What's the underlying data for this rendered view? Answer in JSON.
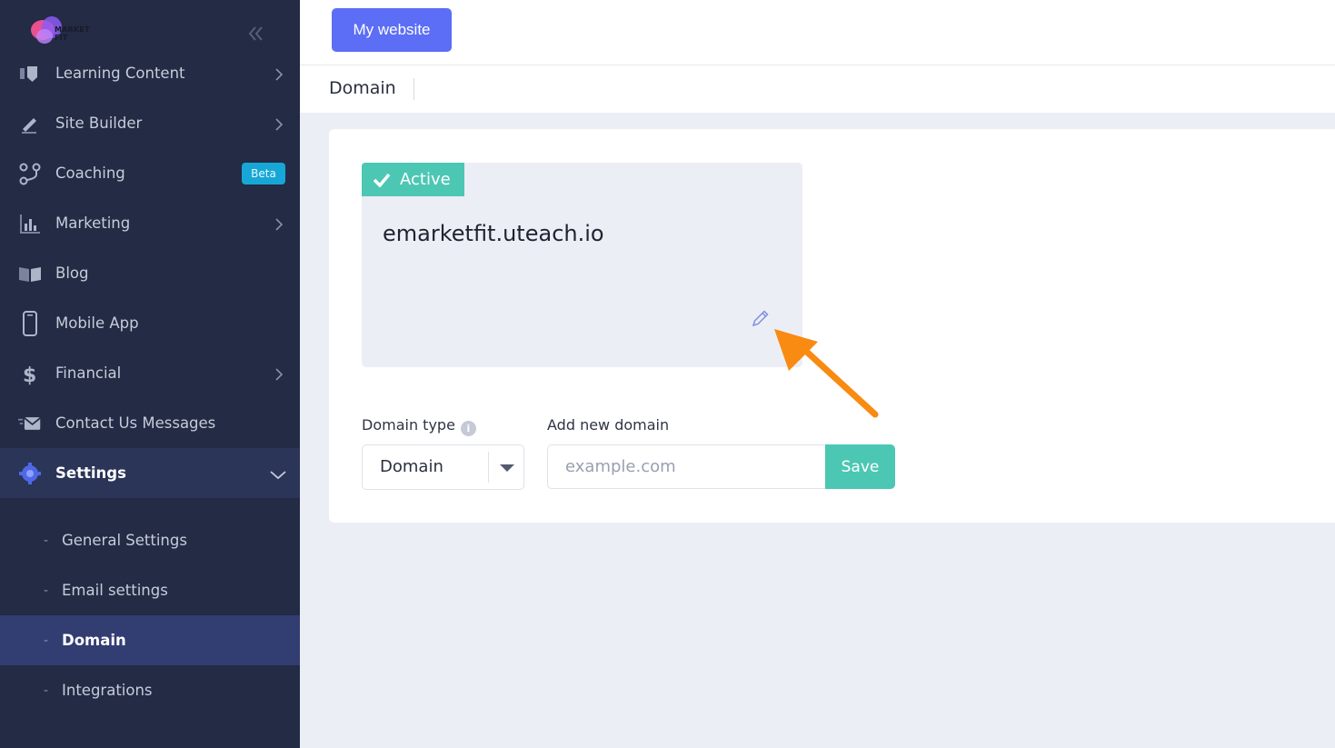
{
  "sidebar": {
    "logo_text": "MARKET FIT",
    "items": [
      {
        "label": "Learning Content",
        "icon": "learning-icon",
        "chevron": true
      },
      {
        "label": "Site Builder",
        "icon": "pencil-icon",
        "chevron": true
      },
      {
        "label": "Coaching",
        "icon": "coaching-icon",
        "badge": "Beta"
      },
      {
        "label": "Marketing",
        "icon": "chart-icon",
        "chevron": true
      },
      {
        "label": "Blog",
        "icon": "book-icon"
      },
      {
        "label": "Mobile App",
        "icon": "mobile-icon"
      },
      {
        "label": "Financial",
        "icon": "dollar-icon",
        "chevron": true
      },
      {
        "label": "Contact Us Messages",
        "icon": "envelope-icon"
      },
      {
        "label": "Settings",
        "icon": "gear-icon",
        "expanded": true
      }
    ],
    "settings_sub": [
      {
        "label": "General Settings"
      },
      {
        "label": "Email settings"
      },
      {
        "label": "Domain",
        "selected": true
      },
      {
        "label": "Integrations"
      }
    ]
  },
  "topbar": {
    "my_website_label": "My website"
  },
  "page": {
    "title": "Domain"
  },
  "domain_card": {
    "status": "Active",
    "domain": "emarketfit.uteach.io"
  },
  "form": {
    "domain_type_label": "Domain type",
    "domain_type_value": "Domain",
    "add_domain_label": "Add new domain",
    "add_domain_placeholder": "example.com",
    "save_label": "Save"
  },
  "colors": {
    "sidebar_bg": "#232b45",
    "accent_teal": "#4cc7b3",
    "button_blue": "#5b6ef5",
    "annotation_arrow": "#f98a12"
  }
}
